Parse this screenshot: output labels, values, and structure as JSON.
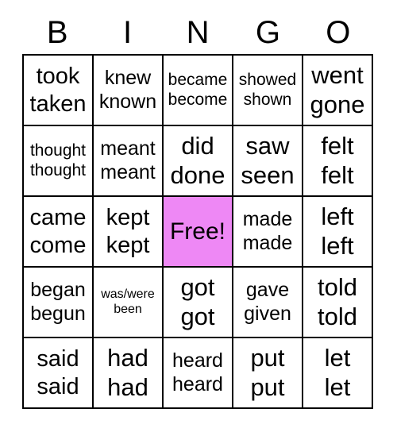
{
  "header": {
    "letters": [
      "B",
      "I",
      "N",
      "G",
      "O"
    ]
  },
  "colors": {
    "free_space_background": "#ee88f5",
    "grid_border": "#000000",
    "cell_background": "#ffffff",
    "text": "#000000"
  },
  "grid": {
    "rows": [
      {
        "cells": [
          {
            "line1": "took",
            "line2": "taken",
            "size": "lg",
            "free": false
          },
          {
            "line1": "knew",
            "line2": "known",
            "size": "md",
            "free": false
          },
          {
            "line1": "became",
            "line2": "become",
            "size": "sm",
            "free": false
          },
          {
            "line1": "showed",
            "line2": "shown",
            "size": "sm",
            "free": false
          },
          {
            "line1": "went",
            "line2": "gone",
            "size": "xl",
            "free": false
          }
        ]
      },
      {
        "cells": [
          {
            "line1": "thought",
            "line2": "thought",
            "size": "sm",
            "free": false
          },
          {
            "line1": "meant",
            "line2": "meant",
            "size": "md",
            "free": false
          },
          {
            "line1": "did",
            "line2": "done",
            "size": "xl",
            "free": false
          },
          {
            "line1": "saw",
            "line2": "seen",
            "size": "xl",
            "free": false
          },
          {
            "line1": "felt",
            "line2": "felt",
            "size": "xl",
            "free": false
          }
        ]
      },
      {
        "cells": [
          {
            "line1": "came",
            "line2": "come",
            "size": "lg",
            "free": false
          },
          {
            "line1": "kept",
            "line2": "kept",
            "size": "lg",
            "free": false
          },
          {
            "line1": "Free!",
            "line2": "",
            "size": "lg",
            "free": true
          },
          {
            "line1": "made",
            "line2": "made",
            "size": "md",
            "free": false
          },
          {
            "line1": "left",
            "line2": "left",
            "size": "xl",
            "free": false
          }
        ]
      },
      {
        "cells": [
          {
            "line1": "began",
            "line2": "begun",
            "size": "md",
            "free": false
          },
          {
            "line1": "was/were",
            "line2": "been",
            "size": "xs",
            "free": false
          },
          {
            "line1": "got",
            "line2": "got",
            "size": "xl",
            "free": false
          },
          {
            "line1": "gave",
            "line2": "given",
            "size": "md",
            "free": false
          },
          {
            "line1": "told",
            "line2": "told",
            "size": "xl",
            "free": false
          }
        ]
      },
      {
        "cells": [
          {
            "line1": "said",
            "line2": "said",
            "size": "lg",
            "free": false
          },
          {
            "line1": "had",
            "line2": "had",
            "size": "xl",
            "free": false
          },
          {
            "line1": "heard",
            "line2": "heard",
            "size": "md",
            "free": false
          },
          {
            "line1": "put",
            "line2": "put",
            "size": "xl",
            "free": false
          },
          {
            "line1": "let",
            "line2": "let",
            "size": "xl",
            "free": false
          }
        ]
      }
    ]
  }
}
